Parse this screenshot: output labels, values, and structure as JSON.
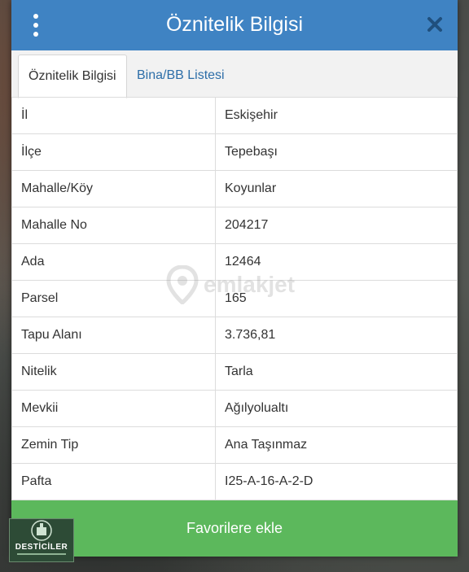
{
  "header": {
    "title": "Öznitelik Bilgisi",
    "menu_icon": "more-vertical-icon",
    "close_icon": "close-icon"
  },
  "tabs": [
    {
      "label": "Öznitelik Bilgisi",
      "active": true
    },
    {
      "label": "Bina/BB Listesi",
      "active": false
    }
  ],
  "attributes": [
    {
      "key": "İl",
      "value": "Eskişehir"
    },
    {
      "key": "İlçe",
      "value": "Tepebaşı"
    },
    {
      "key": "Mahalle/Köy",
      "value": "Koyunlar"
    },
    {
      "key": "Mahalle No",
      "value": "204217"
    },
    {
      "key": "Ada",
      "value": "12464"
    },
    {
      "key": "Parsel",
      "value": "165"
    },
    {
      "key": "Tapu Alanı",
      "value": "3.736,81"
    },
    {
      "key": "Nitelik",
      "value": "Tarla"
    },
    {
      "key": "Mevkii",
      "value": "Ağılyolualtı"
    },
    {
      "key": "Zemin Tip",
      "value": "Ana Taşınmaz"
    },
    {
      "key": "Pafta",
      "value": "I25-A-16-A-2-D"
    }
  ],
  "footer": {
    "favorite_label": "Favorilere ekle"
  },
  "watermark": {
    "text": "emlakjet"
  },
  "logo": {
    "text": "DESTİCİLER"
  },
  "colors": {
    "header_blue": "#3f83c3",
    "tab_link": "#2d6ea8",
    "button_green": "#5cb85c"
  }
}
